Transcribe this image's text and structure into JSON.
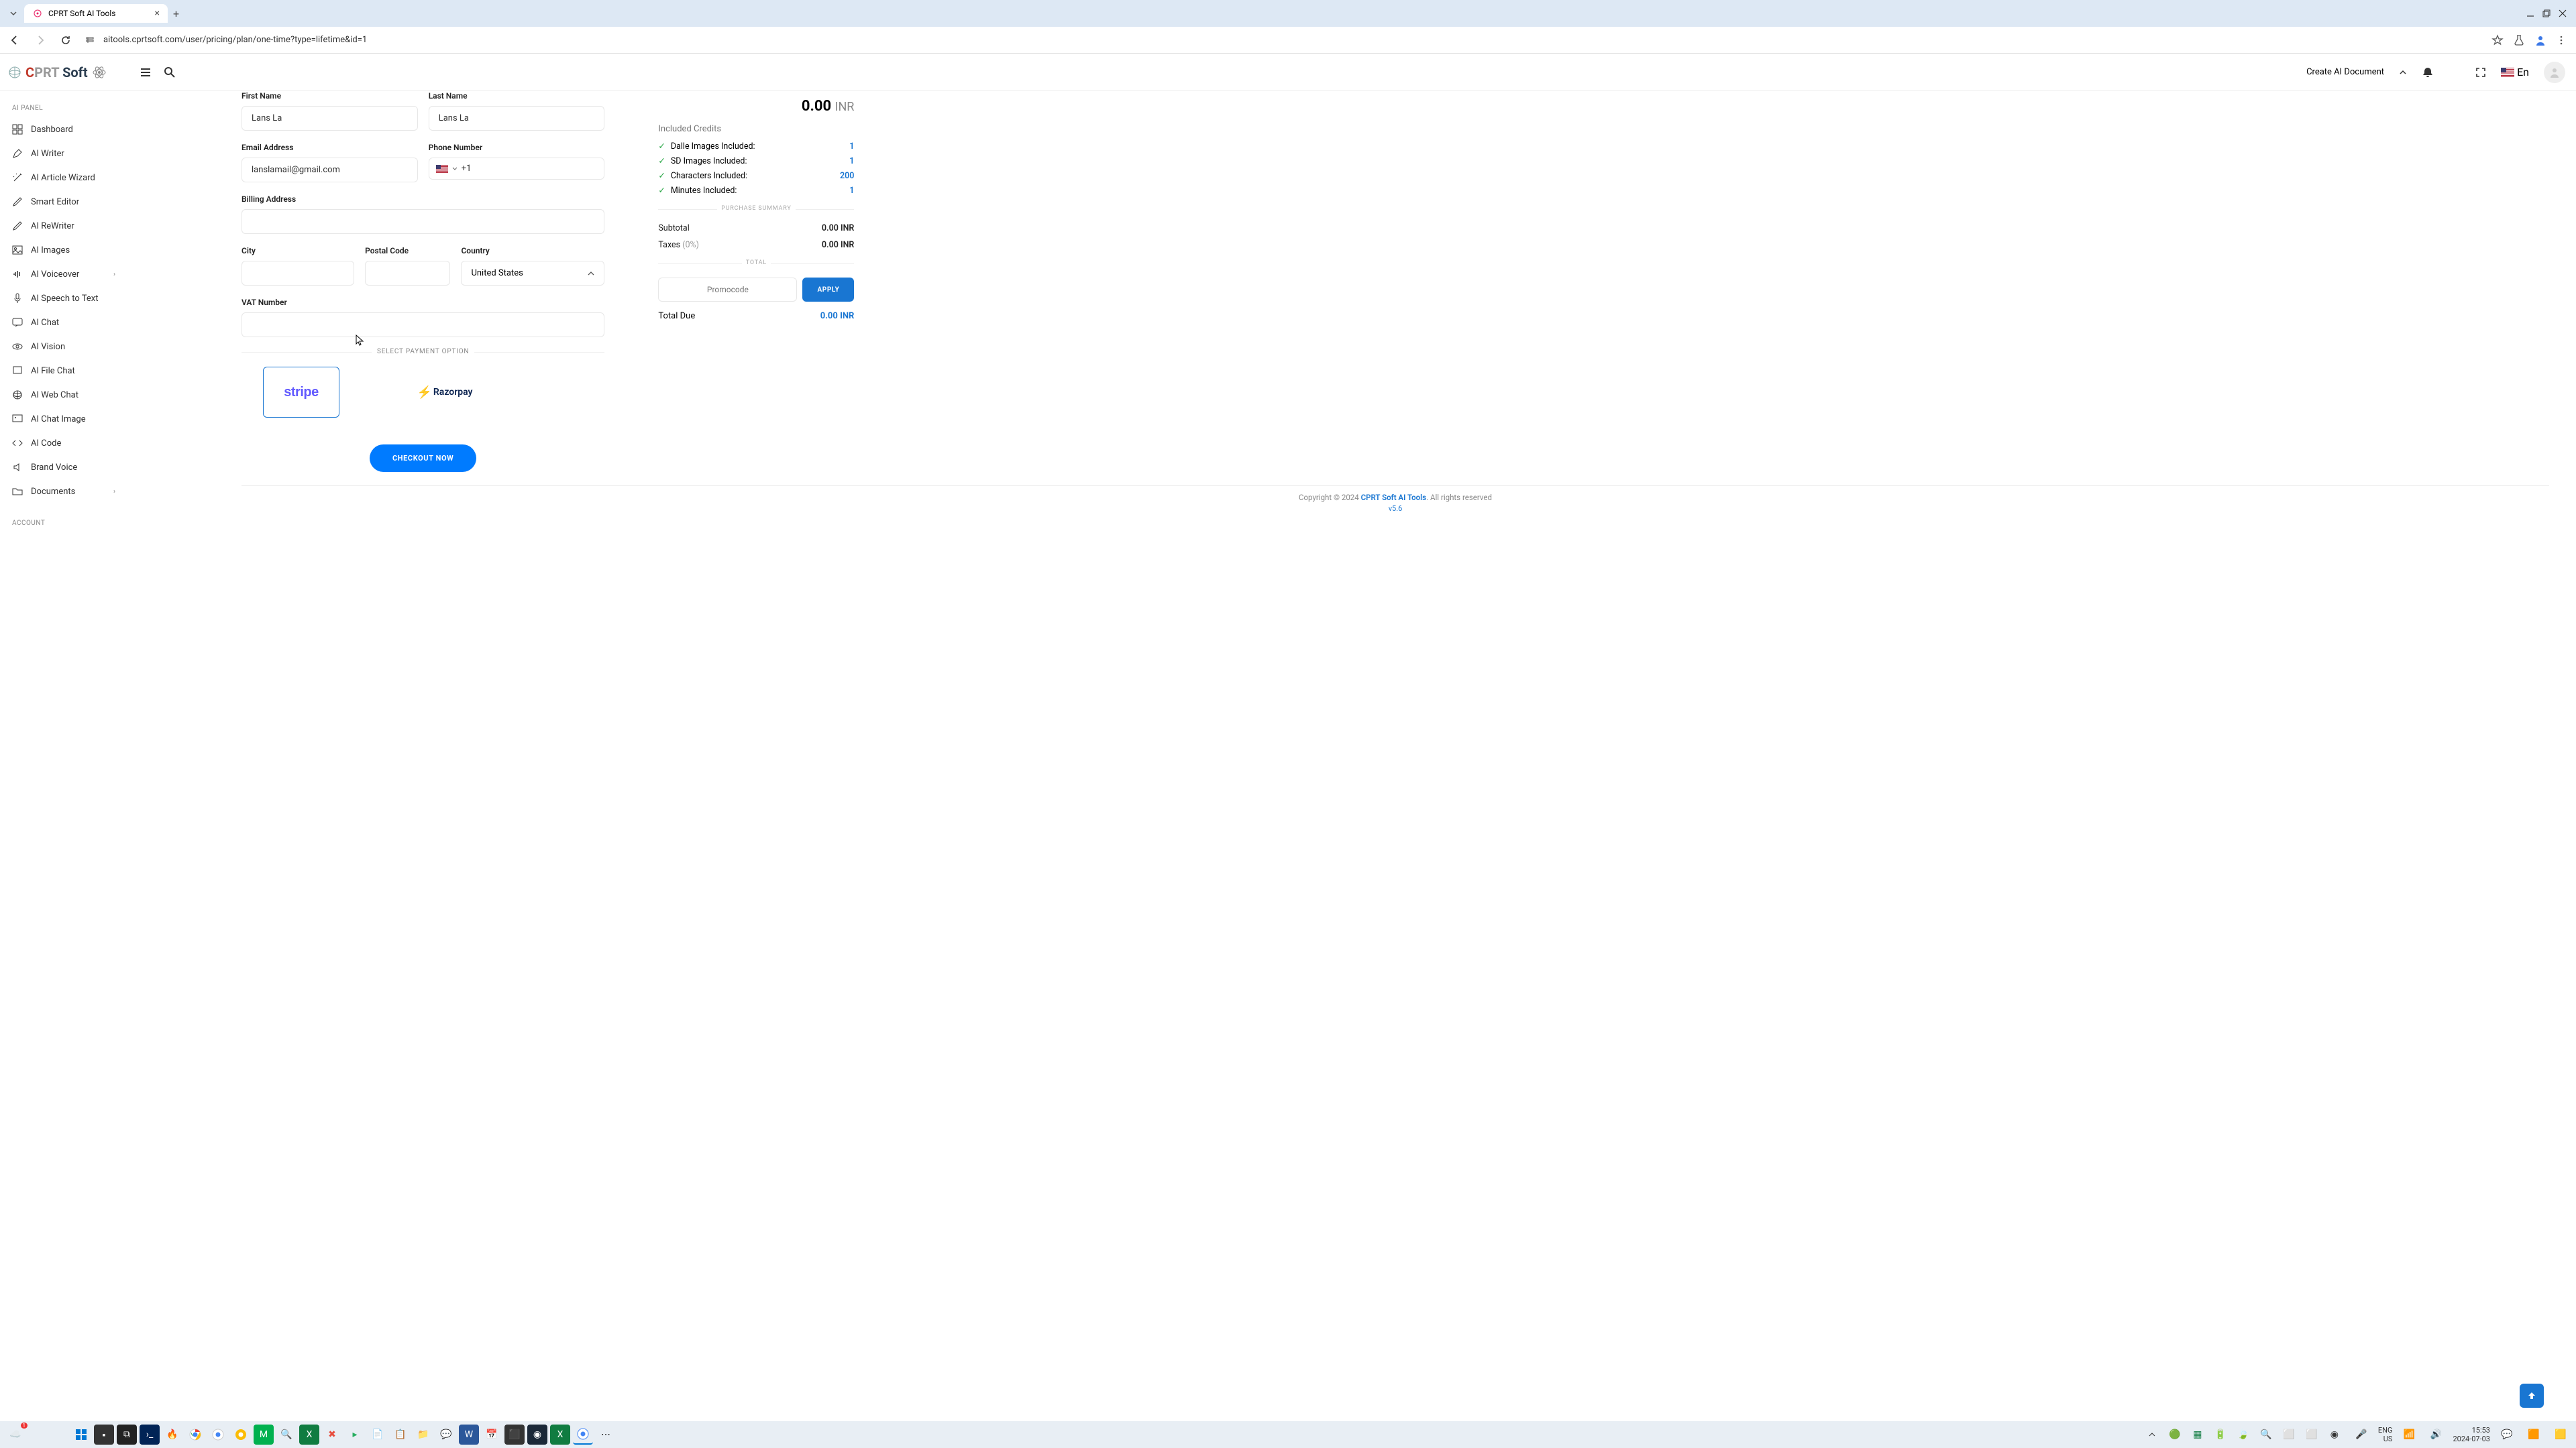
{
  "browser": {
    "tab_title": "CPRT Soft AI Tools",
    "url": "aitools.cprtsoft.com/user/pricing/plan/one-time?type=lifetime&id=1"
  },
  "header": {
    "logo_c": "C",
    "logo_prt": "PRT",
    "logo_soft": " Soft",
    "create_doc": "Create AI Document",
    "lang": "En"
  },
  "sidebar": {
    "section1": "AI PANEL",
    "section2": "ACCOUNT",
    "items": [
      {
        "label": "Dashboard"
      },
      {
        "label": "AI Writer"
      },
      {
        "label": "AI Article Wizard"
      },
      {
        "label": "Smart Editor"
      },
      {
        "label": "AI ReWriter"
      },
      {
        "label": "AI Images"
      },
      {
        "label": "AI Voiceover",
        "chevron": true
      },
      {
        "label": "AI Speech to Text"
      },
      {
        "label": "AI Chat"
      },
      {
        "label": "AI Vision"
      },
      {
        "label": "AI File Chat"
      },
      {
        "label": "AI Web Chat"
      },
      {
        "label": "AI Chat Image"
      },
      {
        "label": "AI Code"
      },
      {
        "label": "Brand Voice"
      },
      {
        "label": "Documents",
        "chevron": true
      }
    ]
  },
  "form": {
    "first_name_label": "First Name",
    "first_name_value": "Lans La",
    "last_name_label": "Last Name",
    "last_name_value": "Lans La",
    "email_label": "Email Address",
    "email_value": "lanslamail@gmail.com",
    "phone_label": "Phone Number",
    "phone_prefix": "+1",
    "billing_label": "Billing Address",
    "city_label": "City",
    "postal_label": "Postal Code",
    "country_label": "Country",
    "country_value": "United States",
    "vat_label": "VAT Number",
    "payment_divider": "SELECT PAYMENT OPTION",
    "stripe": "stripe",
    "razorpay": "Razorpay",
    "checkout": "CHECKOUT NOW"
  },
  "summary": {
    "price": "0.00",
    "currency": "INR",
    "included_title": "Included Credits",
    "credits": [
      {
        "label": "Dalle Images Included:",
        "value": "1"
      },
      {
        "label": "SD Images Included:",
        "value": "1"
      },
      {
        "label": "Characters Included:",
        "value": "200"
      },
      {
        "label": "Minutes Included:",
        "value": "1"
      }
    ],
    "purchase_divider": "PURCHASE SUMMARY",
    "subtotal_label": "Subtotal",
    "subtotal_value": "0.00 INR",
    "taxes_label": "Taxes",
    "taxes_pct": "(0%)",
    "taxes_value": "0.00 INR",
    "total_divider": "TOTAL",
    "promo_placeholder": "Promocode",
    "apply": "APPLY",
    "total_due_label": "Total Due",
    "total_due_value": "0.00 INR"
  },
  "footer": {
    "copyright_pre": "Copyright © 2024 ",
    "brand": "CPRT Soft AI Tools",
    "copyright_post": ". All rights reserved",
    "version": "v5.6"
  },
  "taskbar": {
    "lang1": "ENG",
    "lang2": "US",
    "time": "15:53",
    "date": "2024-07-03"
  }
}
